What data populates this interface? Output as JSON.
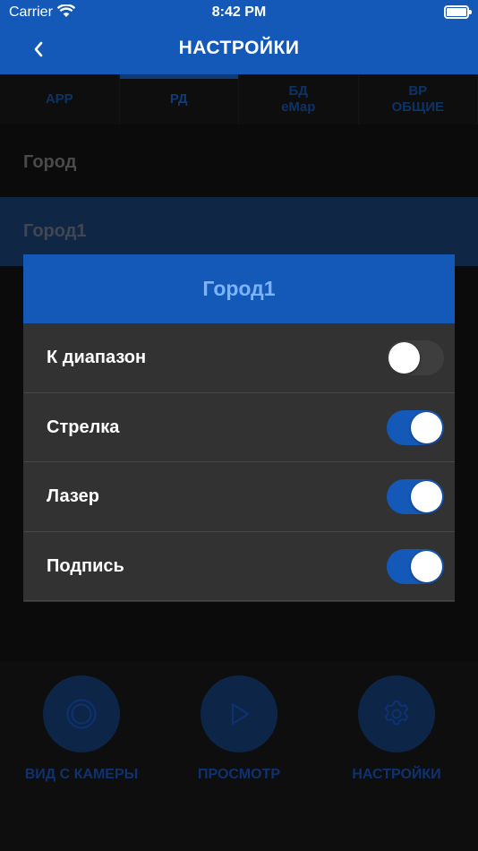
{
  "status_bar": {
    "carrier": "Carrier",
    "time": "8:42 PM"
  },
  "nav": {
    "title": "НАСТРОЙКИ",
    "back_icon": "chevron-left-icon"
  },
  "tabs": [
    {
      "label": "APP",
      "active": false
    },
    {
      "label": "РД",
      "active": true
    },
    {
      "label": "БД\neMap",
      "active": false
    },
    {
      "label": "ВР\nОБЩИЕ",
      "active": false
    }
  ],
  "list": [
    {
      "label": "Город",
      "selected": false
    },
    {
      "label": "Город1",
      "selected": true
    }
  ],
  "dialog": {
    "title": "Город1",
    "options": [
      {
        "label": "К диапазон",
        "enabled": false
      },
      {
        "label": "Стрелка",
        "enabled": true
      },
      {
        "label": "Лазер",
        "enabled": true
      },
      {
        "label": "Подпись",
        "enabled": true
      }
    ]
  },
  "bottom_nav": [
    {
      "label": "ВИД С КАМЕРЫ",
      "icon": "camera-ring-icon"
    },
    {
      "label": "ПРОСМОТР",
      "icon": "play-icon"
    },
    {
      "label": "НАСТРОЙКИ",
      "icon": "gear-icon"
    }
  ],
  "colors": {
    "accent": "#1559b8",
    "dialog_bg": "#323232",
    "dialog_title": "#7ab4ff"
  }
}
